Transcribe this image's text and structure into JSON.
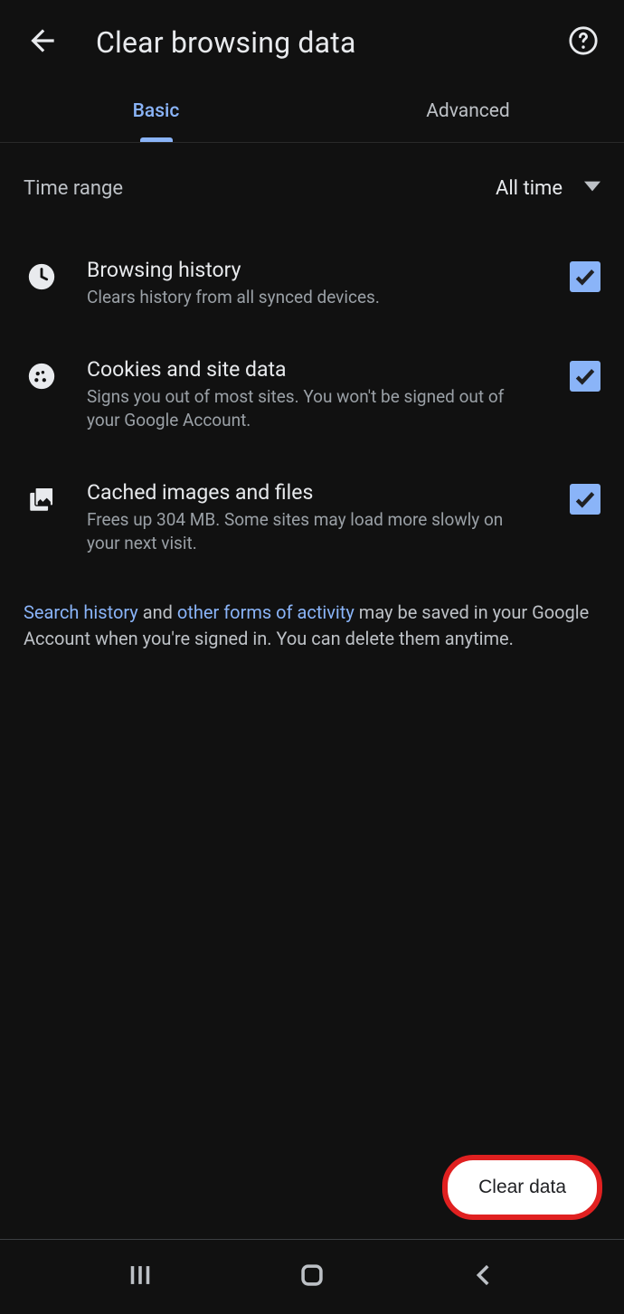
{
  "header": {
    "title": "Clear browsing data"
  },
  "tabs": {
    "basic": "Basic",
    "advanced": "Advanced"
  },
  "time_range": {
    "label": "Time range",
    "value": "All time"
  },
  "options": [
    {
      "title": "Browsing history",
      "desc": "Clears history from all synced devices.",
      "checked": true
    },
    {
      "title": "Cookies and site data",
      "desc": "Signs you out of most sites. You won't be signed out of your Google Account.",
      "checked": true
    },
    {
      "title": "Cached images and files",
      "desc": "Frees up 304 MB. Some sites may load more slowly on your next visit.",
      "checked": true
    }
  ],
  "footnote": {
    "link1": "Search history",
    "mid1": " and ",
    "link2": "other forms of activity",
    "tail": " may be saved in your Google Account when you're signed in. You can delete them anytime."
  },
  "clear_button": "Clear data"
}
